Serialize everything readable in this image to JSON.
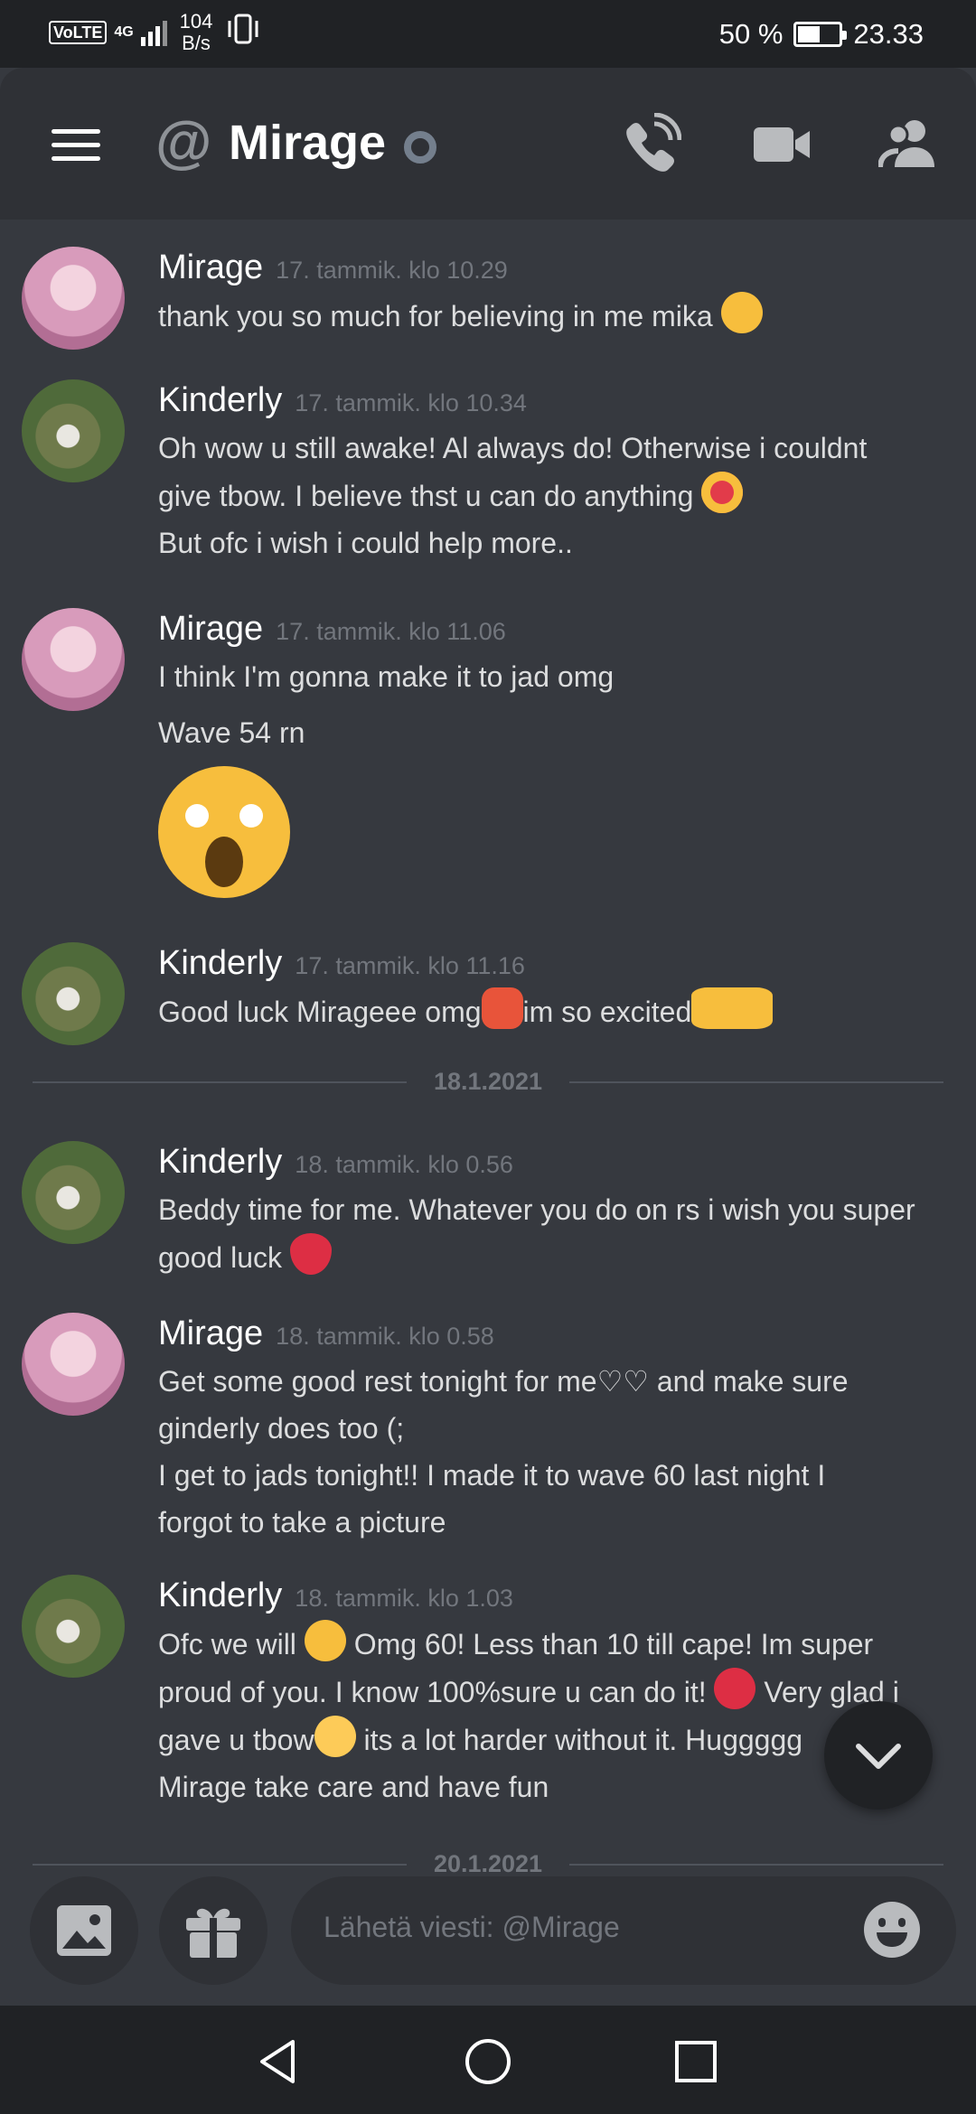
{
  "status_bar": {
    "volte": "VoLTE",
    "network": "4G",
    "speed_value": "104",
    "speed_unit": "B/s",
    "battery_percent": "50 %",
    "battery_level": 0.5,
    "time": "23.33"
  },
  "header": {
    "at": "@",
    "title": "Mirage"
  },
  "messages": [
    {
      "author": "Mirage",
      "timestamp": "17. tammik. klo 10.29",
      "lines": [
        "thank you so much for believing in me mika"
      ],
      "emoji": "smiling-face-with-blush"
    },
    {
      "author": "Kinderly",
      "timestamp": "17. tammik. klo 10.34",
      "lines": [
        "Oh wow u still awake! Al always do! Otherwise i couldnt",
        "give tbow. I believe thst u can do anything",
        "But ofc i wish i could help more.."
      ],
      "emoji": "heart-eyes"
    },
    {
      "author": "Mirage",
      "timestamp": "17. tammik. klo 11.06",
      "lines": [
        "I think I'm gonna make it to jad omg",
        "Wave 54 rn"
      ],
      "emoji": "face-screaming-in-fear"
    },
    {
      "author": "Kinderly",
      "timestamp": "17. tammik. klo 11.16",
      "lines": [
        "Good luck Mirageee omg",
        "im so excited"
      ],
      "emoji": "collision, folded-hands"
    },
    {
      "author": "Kinderly",
      "timestamp": "18. tammik. klo 0.56",
      "lines": [
        "Beddy time for me. Whatever you do on rs i wish you super",
        "good luck"
      ],
      "emoji": "red-heart"
    },
    {
      "author": "Mirage",
      "timestamp": "18. tammik. klo 0.58",
      "lines": [
        "Get some good rest tonight for me♡♡ and make sure",
        "ginderly does too (;",
        "I get to jads tonight!! I made it to wave 60 last night I",
        "forgot to take a picture"
      ]
    },
    {
      "author": "Kinderly",
      "timestamp": "18. tammik. klo 1.03",
      "lines": [
        "Ofc we will",
        "Omg 60! Less than 10 till cape! Im super",
        "proud of you. I know 100%sure u can do it!",
        "Very glad i",
        "gave u tbow",
        "its a lot harder without it. Huggggg",
        "Mirage take care and have fun"
      ],
      "emoji": "smiling-face, red-heart, yellow-heart"
    }
  ],
  "dates": [
    "18.1.2021",
    "20.1.2021"
  ],
  "composer": {
    "placeholder": "Lähetä viesti: @Mirage"
  },
  "icons": {
    "menu": "hamburger-icon",
    "call": "phone-call-icon",
    "video": "video-camera-icon",
    "members": "members-icon",
    "image": "image-icon",
    "gift": "gift-icon",
    "emoji": "smiley-icon",
    "scroll": "chevron-down-icon"
  },
  "colors": {
    "background": "#36393f",
    "header": "#2f3136",
    "statusbar": "#202225",
    "text": "#dcddde",
    "muted": "#72767d"
  }
}
